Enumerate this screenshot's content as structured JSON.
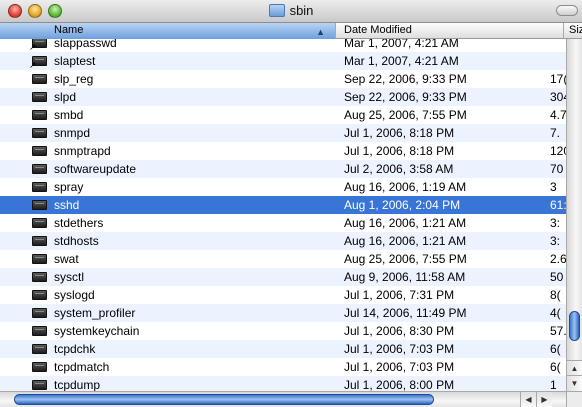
{
  "window": {
    "title": "sbin"
  },
  "columns": {
    "name": "Name",
    "date": "Date Modified",
    "size": "Siz"
  },
  "rows": [
    {
      "name": "slappasswd",
      "date": "Mar 1, 2007, 4:21 AM",
      "size": "",
      "alias": true
    },
    {
      "name": "slaptest",
      "date": "Mar 1, 2007, 4:21 AM",
      "size": "",
      "alias": true
    },
    {
      "name": "slp_reg",
      "date": "Sep 22, 2006, 9:33 PM",
      "size": "17("
    },
    {
      "name": "slpd",
      "date": "Sep 22, 2006, 9:33 PM",
      "size": "304"
    },
    {
      "name": "smbd",
      "date": "Aug 25, 2006, 7:55 PM",
      "size": "4.7"
    },
    {
      "name": "snmpd",
      "date": "Jul 1, 2006, 8:18 PM",
      "size": "7."
    },
    {
      "name": "snmptrapd",
      "date": "Jul 1, 2006, 8:18 PM",
      "size": "120"
    },
    {
      "name": "softwareupdate",
      "date": "Jul 2, 2006, 3:58 AM",
      "size": "70"
    },
    {
      "name": "spray",
      "date": "Aug 16, 2006, 1:19 AM",
      "size": "3"
    },
    {
      "name": "sshd",
      "date": "Aug 1, 2006, 2:04 PM",
      "size": "61:",
      "selected": true
    },
    {
      "name": "stdethers",
      "date": "Aug 16, 2006, 1:21 AM",
      "size": "3:"
    },
    {
      "name": "stdhosts",
      "date": "Aug 16, 2006, 1:21 AM",
      "size": "3:"
    },
    {
      "name": "swat",
      "date": "Aug 25, 2006, 7:55 PM",
      "size": "2.6"
    },
    {
      "name": "sysctl",
      "date": "Aug 9, 2006, 11:58 AM",
      "size": "50"
    },
    {
      "name": "syslogd",
      "date": "Jul 1, 2006, 7:31 PM",
      "size": "8("
    },
    {
      "name": "system_profiler",
      "date": "Jul 14, 2006, 11:49 PM",
      "size": "4("
    },
    {
      "name": "systemkeychain",
      "date": "Jul 1, 2006, 8:30 PM",
      "size": "57."
    },
    {
      "name": "tcpdchk",
      "date": "Jul 1, 2006, 7:03 PM",
      "size": "6("
    },
    {
      "name": "tcpdmatch",
      "date": "Jul 1, 2006, 7:03 PM",
      "size": "6("
    },
    {
      "name": "tcpdump",
      "date": "Jul 1, 2006, 8:00 PM",
      "size": "1"
    }
  ],
  "icons": {
    "file": "unix-executable-icon",
    "folder": "folder-icon"
  },
  "colors": {
    "selection": "#3875d7",
    "alternate_row": "#edf3fe",
    "header_sorted": "#6d9fdc"
  }
}
